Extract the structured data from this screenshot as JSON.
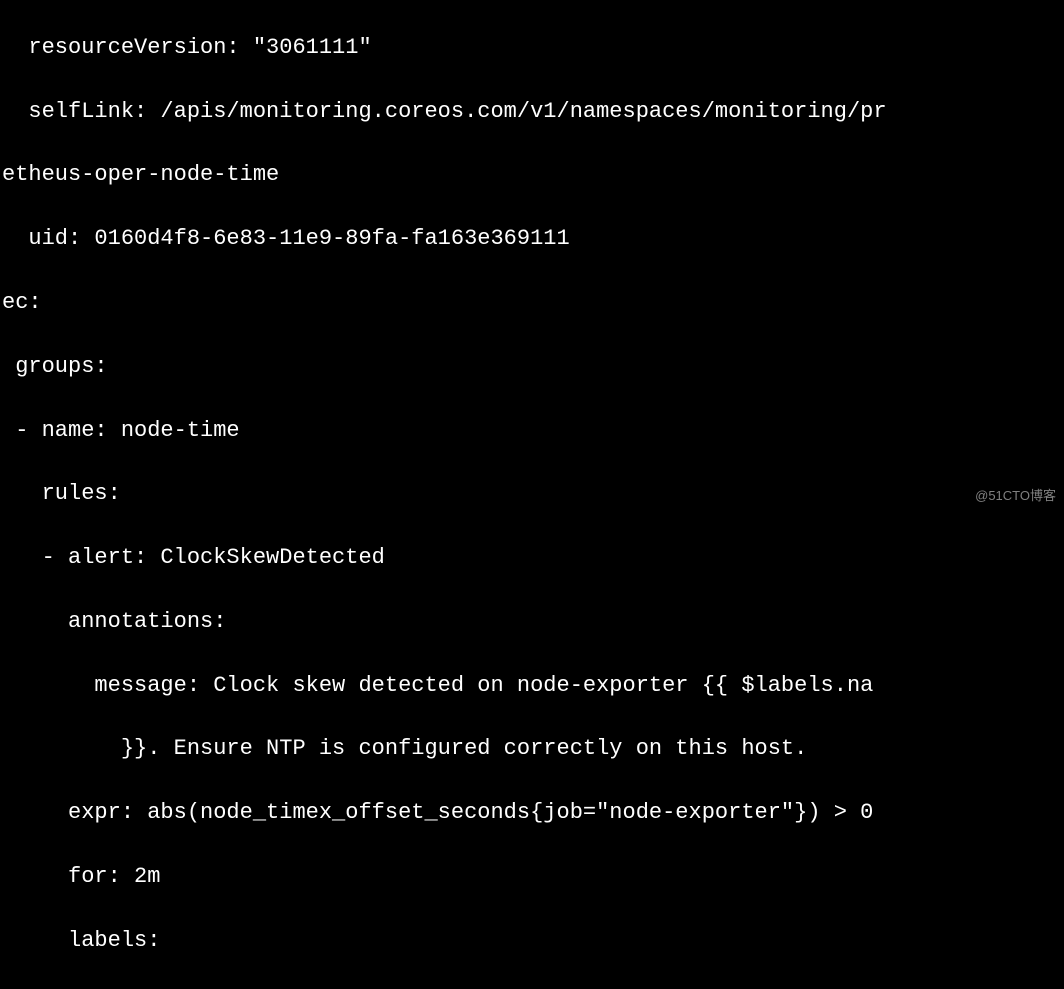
{
  "terminal": {
    "lines": [
      "  resourceVersion: \"3061111\"",
      "  selfLink: /apis/monitoring.coreos.com/v1/namespaces/monitoring/pr",
      "etheus-oper-node-time",
      "  uid: 0160d4f8-6e83-11e9-89fa-fa163e369111",
      "ec:",
      " groups:",
      " - name: node-time",
      "   rules:",
      "   - alert: ClockSkewDetected",
      "     annotations:",
      "       message: Clock skew detected on node-exporter {{ $labels.na",
      "         }}. Ensure NTP is configured correctly on this host.",
      "     expr: abs(node_timex_offset_seconds{job=\"node-exporter\"}) > 0",
      "     for: 2m",
      "     labels:"
    ]
  },
  "watermark": "@51CTO博客"
}
